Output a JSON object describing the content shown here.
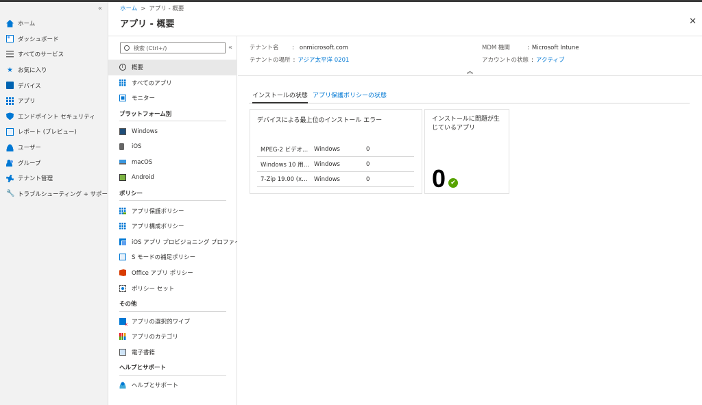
{
  "nav": {
    "collapse": "«",
    "items": [
      {
        "label": "ホーム",
        "icon": "home-icon"
      },
      {
        "label": "ダッシュボード",
        "icon": "dashboard-icon"
      },
      {
        "label": "すべてのサービス",
        "icon": "all-services-icon"
      },
      {
        "label": "お気に入り",
        "icon": "star-icon"
      },
      {
        "label": "デバイス",
        "icon": "devices-icon"
      },
      {
        "label": "アプリ",
        "icon": "apps-icon"
      },
      {
        "label": "エンドポイント セキュリティ",
        "icon": "shield-icon"
      },
      {
        "label": "レポート (プレビュー)",
        "icon": "report-icon"
      },
      {
        "label": "ユーザー",
        "icon": "user-icon"
      },
      {
        "label": "グループ",
        "icon": "group-icon"
      },
      {
        "label": "テナント管理",
        "icon": "tenant-icon"
      },
      {
        "label": "トラブルシューティング + サポート",
        "icon": "wrench-icon"
      }
    ]
  },
  "breadcrumb": {
    "home": "ホーム",
    "separator": ">",
    "current": "アプリ - 概要"
  },
  "page": {
    "title": "アプリ - 概要",
    "close": "✕"
  },
  "submenu": {
    "search_placeholder": "検索 (Ctrl+/)",
    "collapse": "«",
    "top": [
      {
        "label": "概要",
        "active": true
      },
      {
        "label": "すべてのアプリ"
      },
      {
        "label": "モニター"
      }
    ],
    "sections": [
      {
        "header": "プラットフォーム別",
        "items": [
          "Windows",
          "iOS",
          "macOS",
          "Android"
        ]
      },
      {
        "header": "ポリシー",
        "items": [
          "アプリ保護ポリシー",
          "アプリ構成ポリシー",
          "iOS アプリ プロビジョニング プロファイ...",
          "S モードの補足ポリシー",
          "Office アプリ ポリシー",
          "ポリシー セット"
        ]
      },
      {
        "header": "その他",
        "items": [
          "アプリの選択的ワイプ",
          "アプリのカテゴリ",
          "電子書籍"
        ]
      },
      {
        "header": "ヘルプとサポート",
        "items": [
          "ヘルプとサポート"
        ]
      }
    ]
  },
  "essentials": {
    "tenant_name_label": "テナント名",
    "tenant_name_value": "onmicrosoft.com",
    "tenant_location_label": "テナントの場所",
    "tenant_location_value": "アジア太平洋 0201",
    "mdm_label": "MDM 機関",
    "mdm_value": "Microsoft Intune",
    "account_label": "アカウントの状態",
    "account_value": "アクティブ",
    "colon": ":",
    "chevron": "︽"
  },
  "tabs": [
    {
      "label": "インストールの状態",
      "active": true
    },
    {
      "label": "アプリ保護ポリシーの状態",
      "active": false
    }
  ],
  "card_errors": {
    "title": "デバイスによる最上位のインストール エラー",
    "rows": [
      {
        "app": "MPEG-2 ビデオ...",
        "platform": "Windows",
        "count": "0"
      },
      {
        "app": "Windows 10 用 ...",
        "platform": "Windows",
        "count": "0"
      },
      {
        "app": "7-Zip 19.00 (x6...",
        "platform": "Windows",
        "count": "0"
      }
    ]
  },
  "card_failed": {
    "title": "インストールに問題が生じているアプリ",
    "count": "0",
    "check": "✔"
  }
}
